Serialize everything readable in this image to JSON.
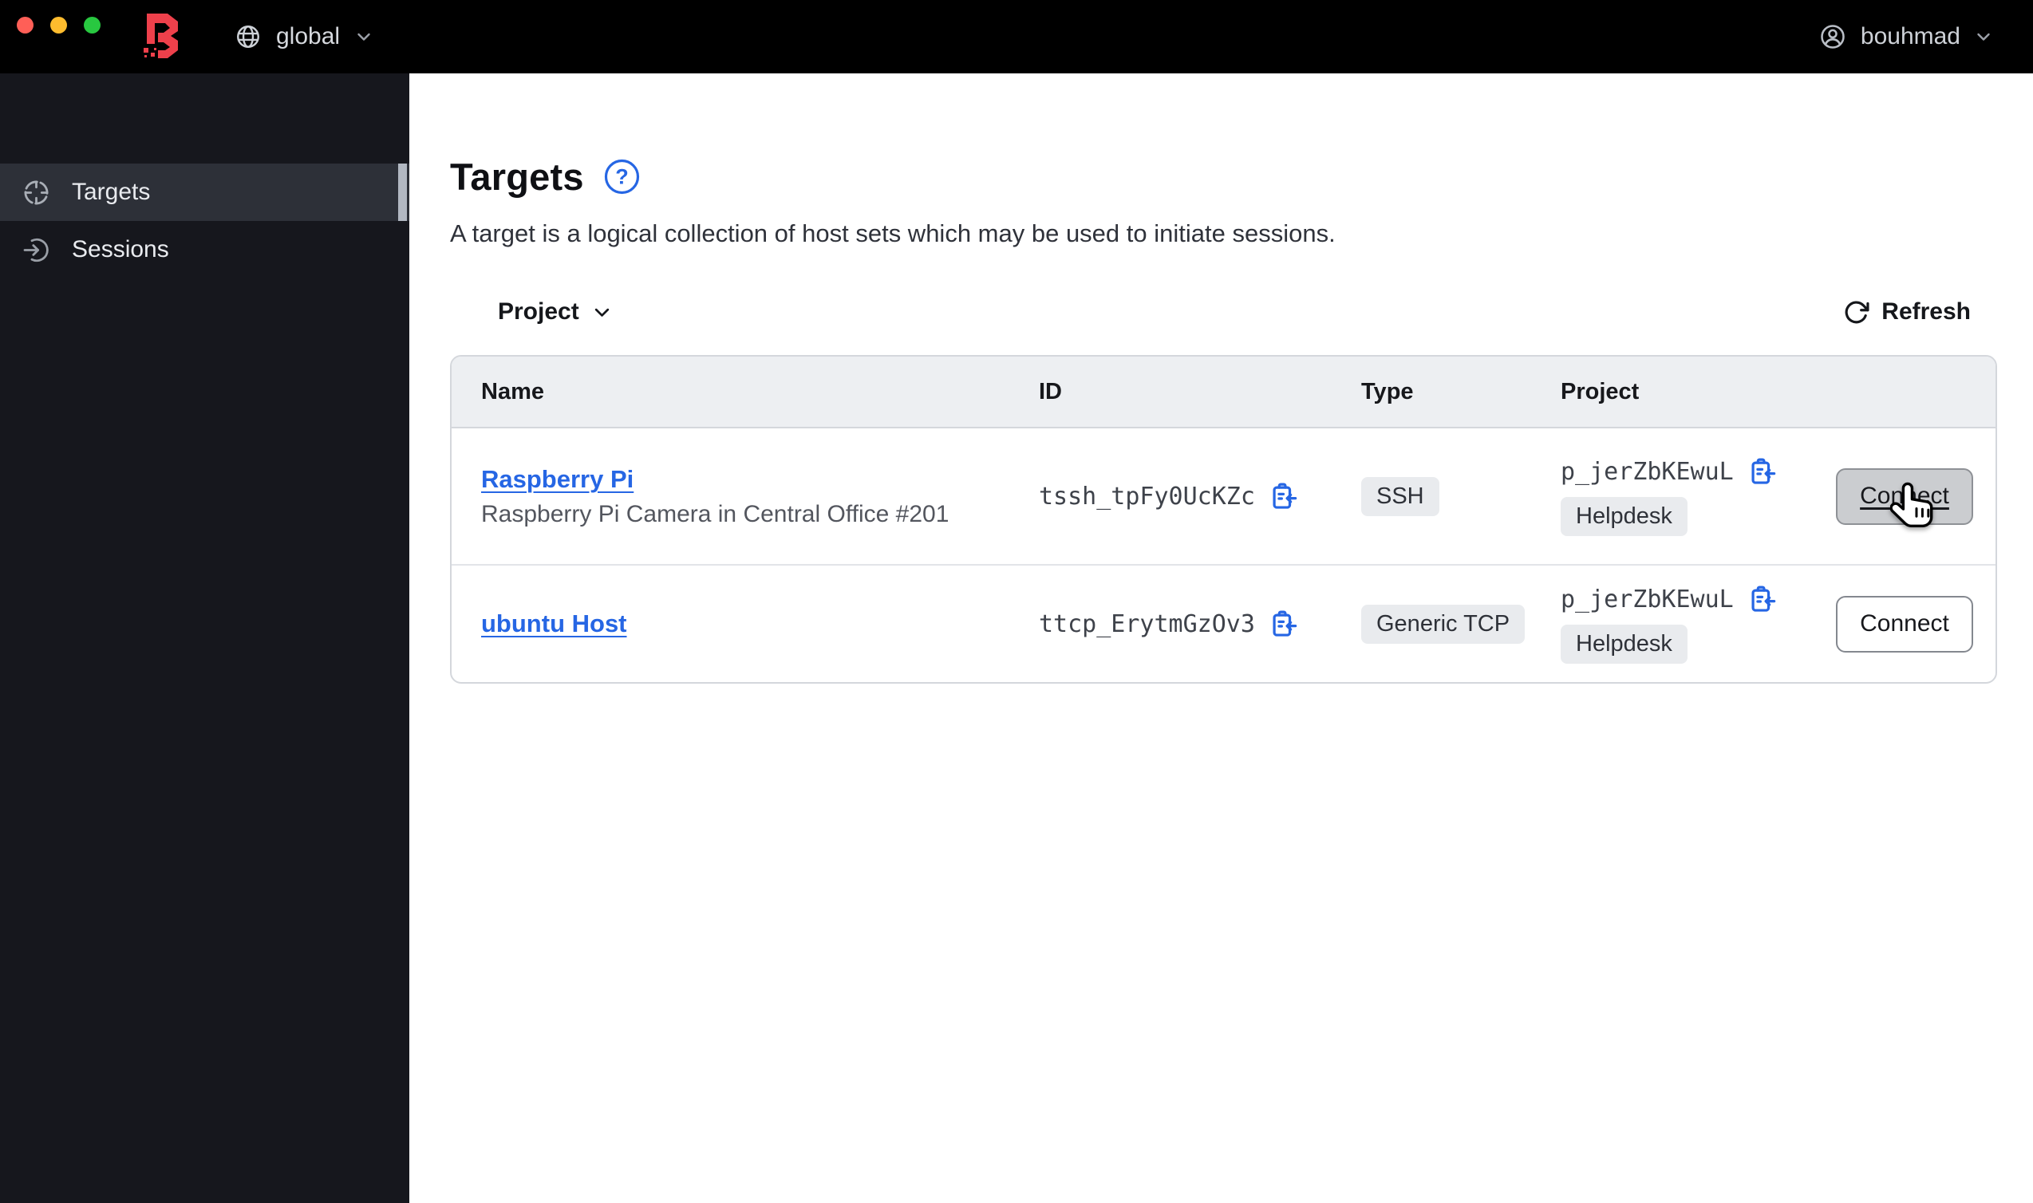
{
  "titlebar": {
    "window_controls": [
      "close",
      "minimize",
      "zoom"
    ],
    "brand": {
      "name": "Boundary",
      "icon": "boundary-logo"
    },
    "scope_switcher": {
      "label": "global",
      "icon": "globe-icon",
      "chevron": "chevron-down-icon"
    },
    "user_menu": {
      "label": "bouhmad",
      "icon": "user-circle-icon",
      "chevron": "chevron-down-icon"
    }
  },
  "sidebar": {
    "items": [
      {
        "label": "Targets",
        "icon": "target-icon",
        "active": true
      },
      {
        "label": "Sessions",
        "icon": "sign-in-icon",
        "active": false
      }
    ]
  },
  "page": {
    "title": "Targets",
    "help_icon": "help-icon",
    "description": "A target is a logical collection of host sets which may be used to initiate sessions.",
    "toolbar": {
      "filter_label": "Project",
      "refresh_label": "Refresh",
      "refresh_icon": "refresh-icon"
    }
  },
  "table": {
    "columns": {
      "name": "Name",
      "id": "ID",
      "type": "Type",
      "project": "Project"
    },
    "copy_icon": "clipboard-copy-icon",
    "rows": [
      {
        "name": "Raspberry Pi",
        "description": "Raspberry Pi Camera in Central Office #201",
        "id": "tssh_tpFy0UcKZc",
        "type": "SSH",
        "project_id": "p_jerZbKEwuL",
        "project_name": "Helpdesk",
        "connect_label": "Connect",
        "state": "hovered"
      },
      {
        "name": "ubuntu Host",
        "description": "",
        "id": "ttcp_ErytmGzOv3",
        "type": "Generic TCP",
        "project_id": "p_jerZbKEwuL",
        "project_name": "Helpdesk",
        "connect_label": "Connect",
        "state": "default"
      }
    ]
  },
  "colors": {
    "titlebar_bg": "#000000",
    "sidebar_bg": "#16171d",
    "sidebar_active_bg": "#2d3038",
    "brand_red": "#ee404b",
    "link_blue": "#2666e4",
    "badge_bg": "#e9ebee",
    "table_header_bg": "#edeff2",
    "traffic_close": "#ff5f57",
    "traffic_minimize": "#febc2e",
    "traffic_zoom": "#28c840"
  }
}
